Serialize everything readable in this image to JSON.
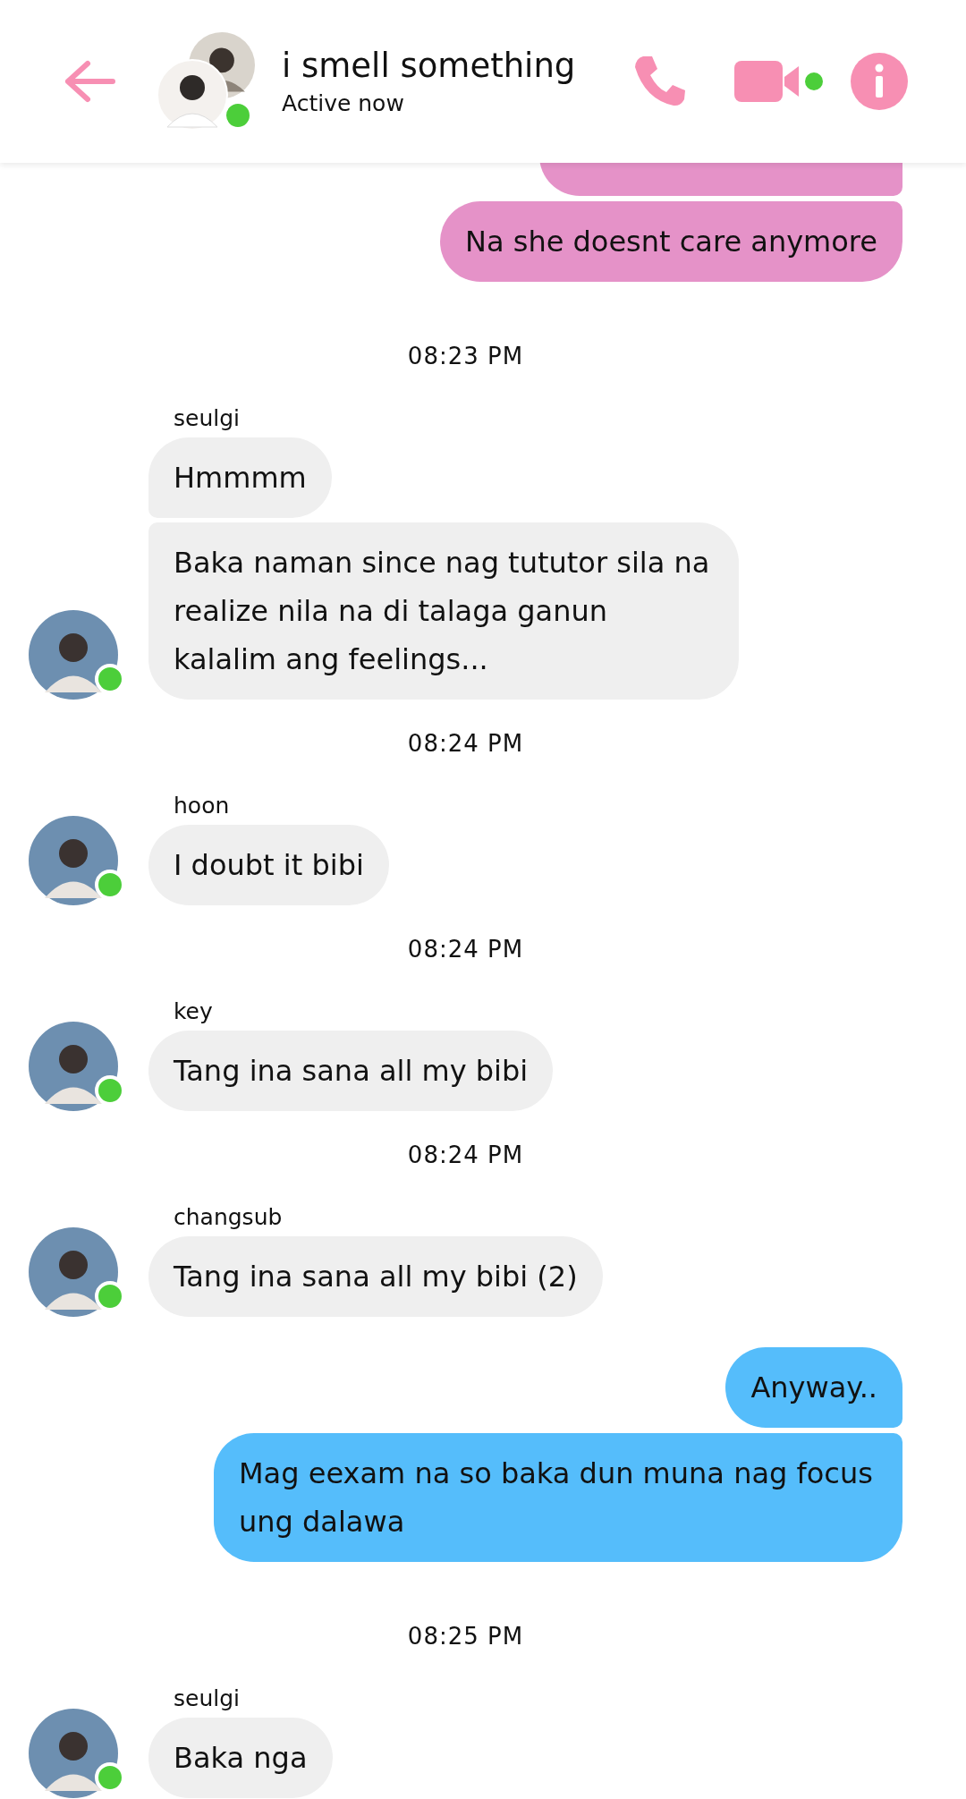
{
  "header": {
    "title": "i smell something",
    "status": "Active now",
    "online": true
  },
  "items": [
    {
      "kind": "outgoing",
      "color": "#e592c8",
      "cut_above": true,
      "bubbles": [
        "Na she doesnt care anymore"
      ]
    },
    {
      "kind": "time",
      "text": "08:23 PM"
    },
    {
      "kind": "incoming",
      "sender": "seulgi",
      "online": true,
      "bubbles": [
        "Hmmmm",
        "Baka naman since nag tututor sila na realize nila na di talaga ganun kalalim ang feelings..."
      ]
    },
    {
      "kind": "time",
      "text": "08:24 PM"
    },
    {
      "kind": "incoming",
      "sender": "hoon",
      "online": true,
      "bubbles": [
        "I doubt it bibi"
      ]
    },
    {
      "kind": "time",
      "text": "08:24 PM"
    },
    {
      "kind": "incoming",
      "sender": "key",
      "online": true,
      "bubbles": [
        "Tang ina sana all my bibi"
      ]
    },
    {
      "kind": "time",
      "text": "08:24 PM"
    },
    {
      "kind": "incoming",
      "sender": "changsub",
      "online": true,
      "bubbles": [
        "Tang ina sana all my bibi (2)"
      ]
    },
    {
      "kind": "outgoing",
      "color": "#55bdfb",
      "bubbles": [
        "Anyway..",
        "Mag eexam na so baka dun muna nag focus ung dalawa"
      ]
    },
    {
      "kind": "time",
      "text": "08:25 PM"
    },
    {
      "kind": "incoming",
      "sender": "seulgi",
      "online": true,
      "bubbles": [
        "Baka nga"
      ]
    }
  ]
}
